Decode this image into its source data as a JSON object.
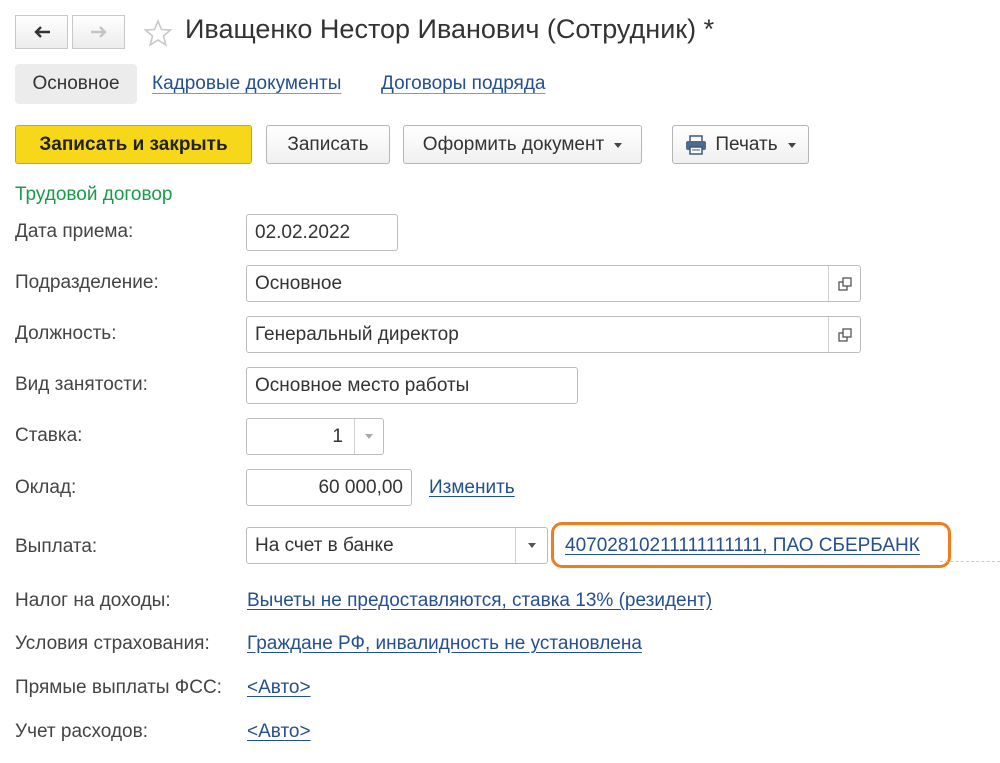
{
  "window": {
    "title": "Иващенко Нестор Иванович (Сотрудник) *",
    "nav": {
      "back_icon": "arrow-left-icon",
      "forward_icon": "arrow-right-icon",
      "favorite_icon": "star-icon"
    }
  },
  "tabs": [
    {
      "label": "Основное",
      "active": true
    },
    {
      "label": "Кадровые документы",
      "active": false
    },
    {
      "label": "Договоры подряда",
      "active": false
    }
  ],
  "toolbar": {
    "save_close_label": "Записать и закрыть",
    "save_label": "Записать",
    "create_doc_label": "Оформить документ",
    "print_label": "Печать"
  },
  "section": {
    "title": "Трудовой договор"
  },
  "form": {
    "hire_date": {
      "label": "Дата приема:",
      "value": "02.02.2022"
    },
    "department": {
      "label": "Подразделение:",
      "value": "Основное"
    },
    "position": {
      "label": "Должность:",
      "value": "Генеральный директор"
    },
    "employment_type": {
      "label": "Вид занятости:",
      "value": "Основное место работы"
    },
    "rate": {
      "label": "Ставка:",
      "value": "1"
    },
    "salary": {
      "label": "Оклад:",
      "value": "60 000,00",
      "change_link": "Изменить"
    },
    "payment": {
      "label": "Выплата:",
      "value": "На счет в банке",
      "account_link": "40702810211111111111, ПАО СБЕРБАНК"
    },
    "income_tax": {
      "label": "Налог на доходы:",
      "value": "Вычеты не предоставляются, ставка 13% (резидент)"
    },
    "insurance": {
      "label": "Условия страхования:",
      "value": "Граждане РФ, инвалидность не установлена"
    },
    "fss": {
      "label": "Прямые выплаты ФСС:",
      "value": "<Авто>"
    },
    "expenses": {
      "label": "Учет расходов:",
      "value": "<Авто>"
    }
  },
  "colors": {
    "accent": "#f6d71a",
    "section": "#1a9b4a",
    "link": "#24508f",
    "highlight": "#ef7d1e"
  }
}
